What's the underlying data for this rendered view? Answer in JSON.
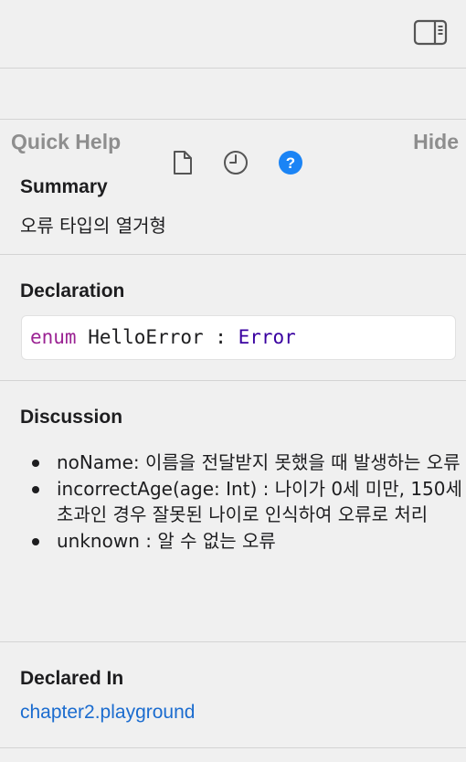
{
  "toolbar": {
    "panel_toggle_icon": "sidebar-right-icon"
  },
  "inspector_tabs": [
    {
      "icon": "file-icon",
      "active": false
    },
    {
      "icon": "history-icon",
      "active": false
    },
    {
      "icon": "help-icon",
      "active": true
    }
  ],
  "quick_help": {
    "title": "Quick Help",
    "hide_label": "Hide"
  },
  "summary": {
    "heading": "Summary",
    "text": "오류 타입의 열거형"
  },
  "declaration": {
    "heading": "Declaration",
    "keyword": "enum",
    "name": " HelloError : ",
    "type": "Error"
  },
  "discussion": {
    "heading": "Discussion",
    "items": [
      "noName: 이름을 전달받지 못했을 때 발생하는 오류",
      "incorrectAge(age: Int) : 나이가 0세 미만, 150세 초과인 경우 잘못된 나이로 인식하여 오류로 처리",
      "unknown : 알 수 없는 오류"
    ]
  },
  "declared_in": {
    "heading": "Declared In",
    "link": "chapter2.playground"
  },
  "colors": {
    "accent": "#1b84f5",
    "link": "#1b6ccf",
    "keyword": "#9b2393",
    "type": "#3900a0"
  }
}
